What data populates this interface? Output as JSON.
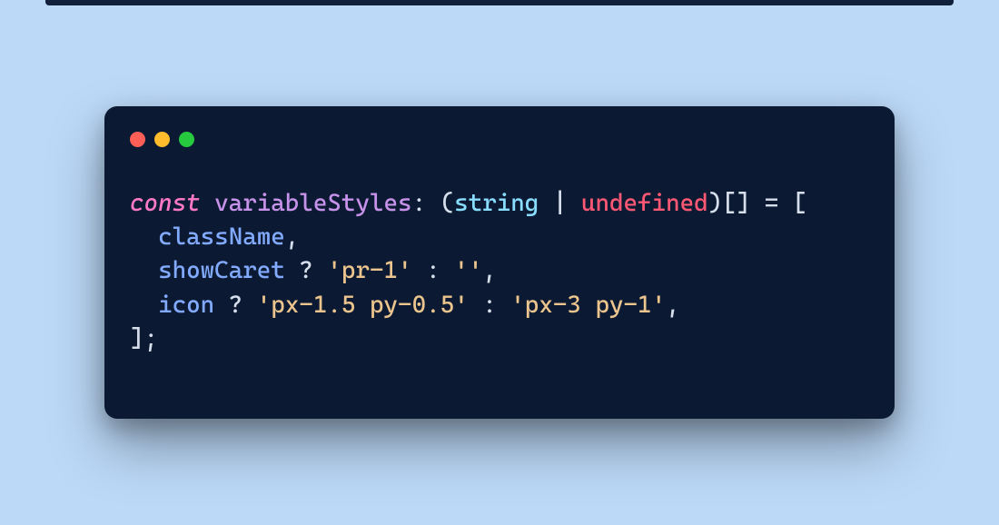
{
  "colors": {
    "background": "#bcd9f8",
    "window": "#0b1a32",
    "close": "#ff5f56",
    "minimize": "#ffbd2e",
    "maximize": "#27c93f"
  },
  "code": {
    "line1": {
      "keyword": "const",
      "space1": " ",
      "identifier": "variableStyles",
      "colon": ":",
      "space2": " ",
      "lparen": "(",
      "type1": "string",
      "space3": " ",
      "pipe": "|",
      "space4": " ",
      "type2": "undefined",
      "rparen": ")",
      "brackets": "[]",
      "space5": " ",
      "equals": "=",
      "space6": " ",
      "lbracket": "["
    },
    "line2": {
      "indent": "  ",
      "prop": "className",
      "comma": ","
    },
    "line3": {
      "indent": "  ",
      "prop": "showCaret",
      "space1": " ",
      "qmark": "?",
      "space2": " ",
      "str1": "'pr-1'",
      "space3": " ",
      "colon": ":",
      "space4": " ",
      "str2": "''",
      "comma": ","
    },
    "line4": {
      "indent": "  ",
      "prop": "icon",
      "space1": " ",
      "qmark": "?",
      "space2": " ",
      "str1": "'px-1.5 py-0.5'",
      "space3": " ",
      "colon": ":",
      "space4": " ",
      "str2": "'px-3 py-1'",
      "comma": ","
    },
    "line5": {
      "rbracket": "]",
      "semi": ";"
    }
  }
}
